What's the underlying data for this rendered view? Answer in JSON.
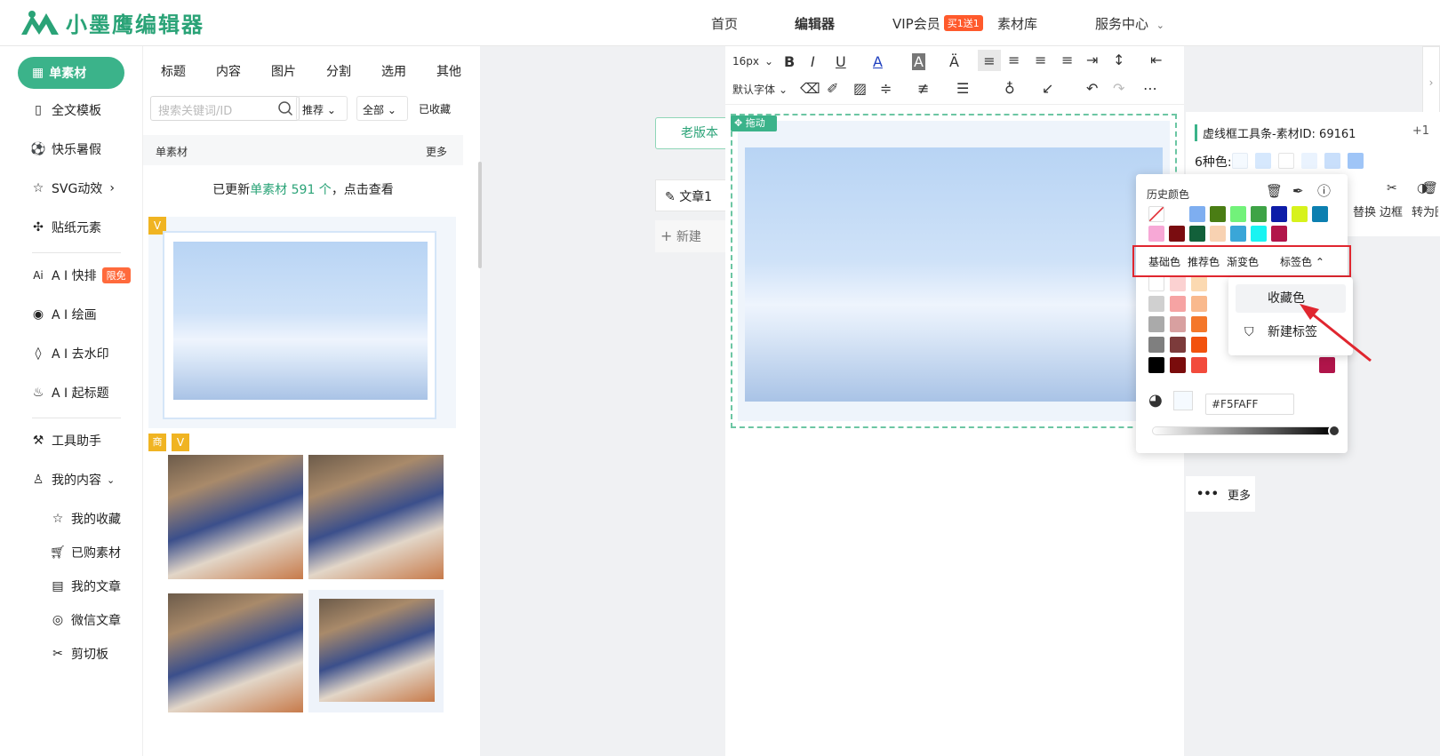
{
  "header": {
    "logo_text": "小墨鹰编辑器",
    "nav": [
      "首页",
      "编辑器",
      "VIP会员",
      "素材库",
      "服务中心"
    ],
    "vip_badge": "买1送1"
  },
  "leftnav": {
    "items": [
      {
        "label": "单素材",
        "icon": "grid-icon"
      },
      {
        "label": "全文模板",
        "icon": "template-icon"
      },
      {
        "label": "快乐暑假",
        "icon": "soccer-icon"
      },
      {
        "label": "SVG动效",
        "icon": "star-icon"
      },
      {
        "label": "贴纸元素",
        "icon": "puzzle-icon"
      },
      {
        "label": "A I 快排",
        "icon": "ai-icon",
        "badge": "限免"
      },
      {
        "label": "A I 绘画",
        "icon": "palette-icon"
      },
      {
        "label": "A I 去水印",
        "icon": "drop-icon"
      },
      {
        "label": "A I 起标题",
        "icon": "fire-icon"
      },
      {
        "label": "工具助手",
        "icon": "tools-icon"
      },
      {
        "label": "我的内容",
        "icon": "user-icon"
      }
    ],
    "sub_items": [
      "我的收藏",
      "已购素材",
      "我的文章",
      "微信文章",
      "剪切板"
    ]
  },
  "panel": {
    "tabs": [
      "标题",
      "内容",
      "图片",
      "分割",
      "选用",
      "其他"
    ],
    "search_placeholder": "搜索关键词/ID",
    "filter_sort": "推荐",
    "filter_scope": "全部",
    "favorites": "已收藏",
    "section_title": "单素材",
    "section_more": "更多",
    "update_prefix": "已更新",
    "update_highlight": "单素材 591 个",
    "update_suffix": "，点击查看",
    "badge_v": "V",
    "badge_shang": "商"
  },
  "editor": {
    "old_version": "老版本",
    "doc_tab": "文章1",
    "new_tab": "新建",
    "font_size": "16px",
    "font_family": "默认字体",
    "drag_label": "拖动"
  },
  "right_panel": {
    "title": "虚线框工具条-素材ID: 69161",
    "plus": "+1",
    "colors_label": "6种色:",
    "colors": [
      "#f5faff",
      "#d6e8fd",
      "#ffffff",
      "#eaf3fe",
      "#c9dffb",
      "#9fc5f7"
    ],
    "actions": [
      "替换",
      "边框",
      "转为图"
    ],
    "more": "更多"
  },
  "picker": {
    "history_label": "历史颜色",
    "history_colors": [
      "#7eaef0",
      "#4a7d14",
      "#72f27a",
      "#3ea346",
      "#0d1ca8",
      "#d7f21c",
      "#0c7fb0",
      "#f7a8d6",
      "#7a0c10",
      "#12603a",
      "#f8d2b2",
      "#3aa6d8",
      "#19f4f2",
      "#b2164a"
    ],
    "tabs": [
      "基础色",
      "推荐色",
      "渐变色",
      "标签色"
    ],
    "grid_colors": [
      [
        "#ffffff",
        "#fbd1d1",
        "#fbd9b1"
      ],
      [
        "#d0d0d0",
        "#f6a3a3",
        "#f9b98d"
      ],
      [
        "#aaaaaa",
        "#d8a0a0",
        "#f4772a"
      ],
      [
        "#7f7f7f",
        "#7c3b3b",
        "#f2520e"
      ],
      [
        "#000000",
        "#7a0c0c",
        "#f24b3c"
      ]
    ],
    "grid_right_colors": [
      [
        "#eed0dc"
      ],
      [
        "#d94a86"
      ],
      [
        "#c73c6a"
      ],
      [
        "#c22d52"
      ],
      [
        "#b0154a"
      ]
    ],
    "hex_value": "#F5FAFF",
    "dropdown": [
      "收藏色",
      "新建标签"
    ]
  }
}
